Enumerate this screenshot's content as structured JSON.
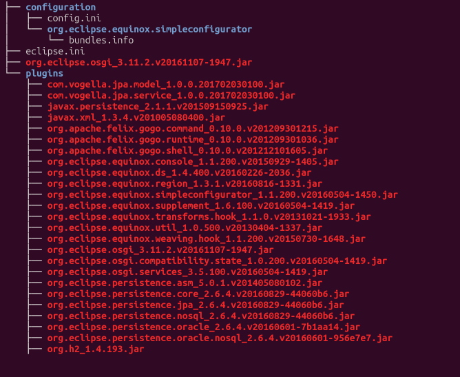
{
  "tree": [
    {
      "prefix": "├── ",
      "name": "configuration",
      "cls": "dir"
    },
    {
      "prefix": "│   ├── ",
      "name": "config.ini",
      "cls": "reg"
    },
    {
      "prefix": "│   └── ",
      "name": "org.eclipse.equinox.simpleconfigurator",
      "cls": "dir"
    },
    {
      "prefix": "│       └── ",
      "name": "bundles.info",
      "cls": "reg"
    },
    {
      "prefix": "├── ",
      "name": "eclipse.ini",
      "cls": "reg"
    },
    {
      "prefix": "├── ",
      "name": "org.eclipse.osgi_3.11.2.v20161107-1947.jar",
      "cls": "art"
    },
    {
      "prefix": "└── ",
      "name": "plugins",
      "cls": "dir"
    },
    {
      "prefix": "    ├── ",
      "name": "com.vogella.jpa.model_1.0.0.201702030100.jar",
      "cls": "art"
    },
    {
      "prefix": "    ├── ",
      "name": "com.vogella.jpa.service_1.0.0.201702030100.jar",
      "cls": "art"
    },
    {
      "prefix": "    ├── ",
      "name": "javax.persistence_2.1.1.v201509150925.jar",
      "cls": "art"
    },
    {
      "prefix": "    ├── ",
      "name": "javax.xml_1.3.4.v201005080400.jar",
      "cls": "art"
    },
    {
      "prefix": "    ├── ",
      "name": "org.apache.felix.gogo.command_0.10.0.v201209301215.jar",
      "cls": "art"
    },
    {
      "prefix": "    ├── ",
      "name": "org.apache.felix.gogo.runtime_0.10.0.v201209301036.jar",
      "cls": "art"
    },
    {
      "prefix": "    ├── ",
      "name": "org.apache.felix.gogo.shell_0.10.0.v201212101605.jar",
      "cls": "art"
    },
    {
      "prefix": "    ├── ",
      "name": "org.eclipse.equinox.console_1.1.200.v20150929-1405.jar",
      "cls": "art"
    },
    {
      "prefix": "    ├── ",
      "name": "org.eclipse.equinox.ds_1.4.400.v20160226-2036.jar",
      "cls": "art"
    },
    {
      "prefix": "    ├── ",
      "name": "org.eclipse.equinox.region_1.3.1.v20160816-1331.jar",
      "cls": "art"
    },
    {
      "prefix": "    ├── ",
      "name": "org.eclipse.equinox.simpleconfigurator_1.1.200.v20160504-1450.jar",
      "cls": "art"
    },
    {
      "prefix": "    ├── ",
      "name": "org.eclipse.equinox.supplement_1.6.100.v20160504-1419.jar",
      "cls": "art"
    },
    {
      "prefix": "    ├── ",
      "name": "org.eclipse.equinox.transforms.hook_1.1.0.v20131021-1933.jar",
      "cls": "art"
    },
    {
      "prefix": "    ├── ",
      "name": "org.eclipse.equinox.util_1.0.500.v20130404-1337.jar",
      "cls": "art"
    },
    {
      "prefix": "    ├── ",
      "name": "org.eclipse.equinox.weaving.hook_1.1.200.v20150730-1648.jar",
      "cls": "art"
    },
    {
      "prefix": "    ├── ",
      "name": "org.eclipse.osgi_3.11.2.v20161107-1947.jar",
      "cls": "art"
    },
    {
      "prefix": "    ├── ",
      "name": "org.eclipse.osgi.compatibility.state_1.0.200.v20160504-1419.jar",
      "cls": "art"
    },
    {
      "prefix": "    ├── ",
      "name": "org.eclipse.osgi.services_3.5.100.v20160504-1419.jar",
      "cls": "art"
    },
    {
      "prefix": "    ├── ",
      "name": "org.eclipse.persistence.asm_5.0.1.v201405080102.jar",
      "cls": "art"
    },
    {
      "prefix": "    ├── ",
      "name": "org.eclipse.persistence.core_2.6.4.v20160829-44060b6.jar",
      "cls": "art"
    },
    {
      "prefix": "    ├── ",
      "name": "org.eclipse.persistence.jpa_2.6.4.v20160829-44060b6.jar",
      "cls": "art"
    },
    {
      "prefix": "    ├── ",
      "name": "org.eclipse.persistence.nosql_2.6.4.v20160829-44060b6.jar",
      "cls": "art"
    },
    {
      "prefix": "    ├── ",
      "name": "org.eclipse.persistence.oracle_2.6.4.v20160601-7b1aa14.jar",
      "cls": "art"
    },
    {
      "prefix": "    ├── ",
      "name": "org.eclipse.persistence.oracle.nosql_2.6.4.v20160601-956e7e7.jar",
      "cls": "art"
    },
    {
      "prefix": "    ├── ",
      "name": "org.h2_1.4.193.jar",
      "cls": "art"
    }
  ]
}
